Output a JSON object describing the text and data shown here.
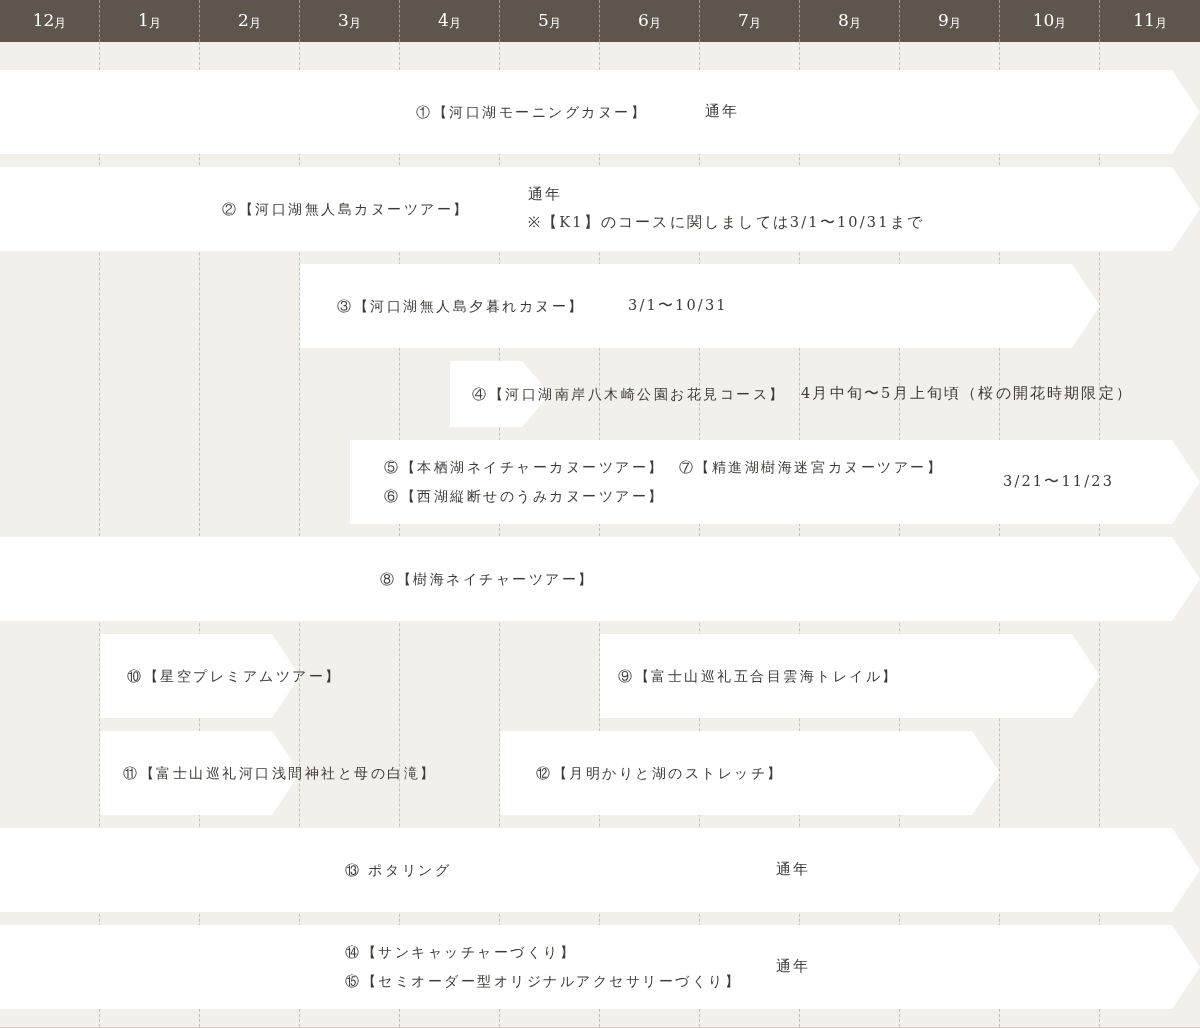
{
  "months": [
    {
      "number": "12",
      "unit": "月"
    },
    {
      "number": "1",
      "unit": "月"
    },
    {
      "number": "2",
      "unit": "月"
    },
    {
      "number": "3",
      "unit": "月"
    },
    {
      "number": "4",
      "unit": "月"
    },
    {
      "number": "5",
      "unit": "月"
    },
    {
      "number": "6",
      "unit": "月"
    },
    {
      "number": "7",
      "unit": "月"
    },
    {
      "number": "8",
      "unit": "月"
    },
    {
      "number": "9",
      "unit": "月"
    },
    {
      "number": "10",
      "unit": "月"
    },
    {
      "number": "11",
      "unit": "月"
    }
  ],
  "rows": [
    {
      "bars": [
        {
          "lines": [
            [
              "①【河口湖モーニングカヌー】"
            ]
          ],
          "period": [
            "通年"
          ]
        }
      ]
    },
    {
      "bars": [
        {
          "lines": [
            [
              "②【河口湖無人島カヌーツアー】"
            ]
          ],
          "period": [
            "通年",
            "※【K1】のコースに関しましては3/1〜10/31まで"
          ]
        }
      ]
    },
    {
      "bars": [
        {
          "lines": [
            [
              "③【河口湖無人島夕暮れカヌー】"
            ]
          ],
          "period": [
            "3/1〜10/31"
          ]
        }
      ]
    },
    {
      "bars": [
        {
          "lines": [
            [
              "④【河口湖南岸八木崎公園お花見コース】"
            ]
          ],
          "period": [
            "4月中旬〜5月上旬頃（桜の開花時期限定）"
          ]
        }
      ]
    },
    {
      "bars": [
        {
          "lines": [
            [
              "⑤【本栖湖ネイチャーカヌーツアー】",
              "⑦【精進湖樹海迷宮カヌーツアー】"
            ],
            [
              "⑥【西湖縦断せのうみカヌーツアー】"
            ]
          ],
          "period": [
            "3/21〜11/23"
          ]
        }
      ]
    },
    {
      "bars": [
        {
          "lines": [
            [
              "⑧【樹海ネイチャーツアー】"
            ]
          ]
        }
      ]
    },
    {
      "bars": [
        {
          "lines": [
            [
              "⑩【星空プレミアムツアー】"
            ]
          ]
        },
        {
          "lines": [
            [
              "⑨【富士山巡礼五合目雲海トレイル】"
            ]
          ]
        }
      ]
    },
    {
      "bars": [
        {
          "lines": [
            [
              "⑪【富士山巡礼河口浅間神社と母の白滝】"
            ]
          ]
        },
        {
          "lines": [
            [
              "⑫【月明かりと湖のストレッチ】"
            ]
          ]
        }
      ]
    },
    {
      "bars": [
        {
          "lines": [
            [
              "⑬ ポタリング"
            ]
          ],
          "period": [
            "通年"
          ]
        }
      ]
    },
    {
      "bars": [
        {
          "lines": [
            [
              "⑭【サンキャッチャーづくり】"
            ],
            [
              "⑮【セミオーダー型オリジナルアクセサリーづくり】"
            ]
          ],
          "period": [
            "通年"
          ]
        }
      ]
    }
  ]
}
